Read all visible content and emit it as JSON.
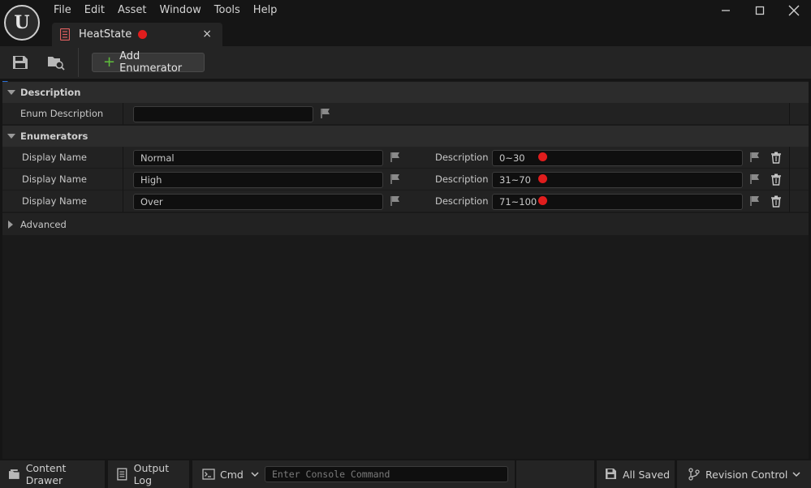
{
  "menu": [
    "File",
    "Edit",
    "Asset",
    "Window",
    "Tools",
    "Help"
  ],
  "tab": {
    "label": "HeatState"
  },
  "toolbar": {
    "add_enumerator": "Add Enumerator"
  },
  "sections": {
    "description": {
      "title": "Description",
      "field_label": "Enum Description",
      "value": ""
    },
    "enumerators": {
      "title": "Enumerators",
      "rows": [
        {
          "name_label": "Display Name",
          "display_name": "Normal",
          "desc_label": "Description",
          "description": "0~30"
        },
        {
          "name_label": "Display Name",
          "display_name": "High",
          "desc_label": "Description",
          "description": "31~70"
        },
        {
          "name_label": "Display Name",
          "display_name": "Over",
          "desc_label": "Description",
          "description": "71~100"
        }
      ]
    },
    "advanced": {
      "title": "Advanced"
    }
  },
  "statusbar": {
    "content_drawer": "Content Drawer",
    "output_log": "Output Log",
    "cmd": "Cmd",
    "console_placeholder": "Enter Console Command",
    "all_saved": "All Saved",
    "revision_control": "Revision Control"
  },
  "colors": {
    "accent": "#2b70d8",
    "dirty": "#e01d1d",
    "add": "#5fbf3c"
  }
}
